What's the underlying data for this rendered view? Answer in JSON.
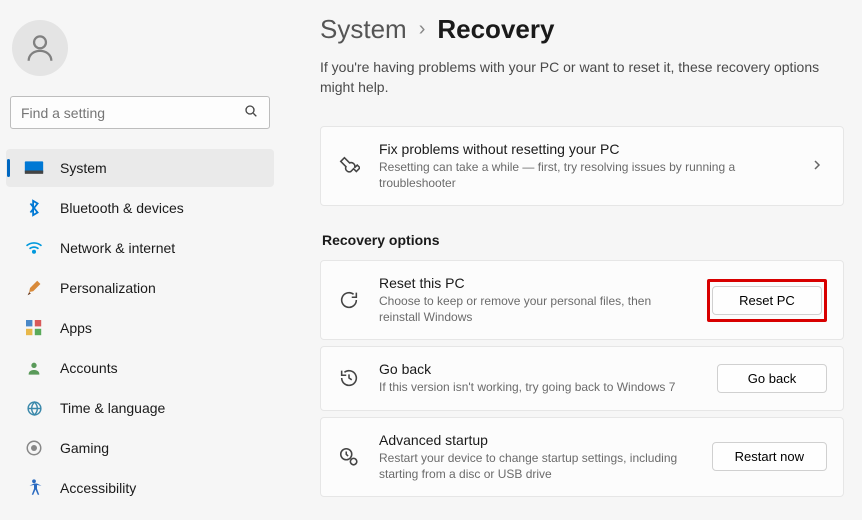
{
  "search": {
    "placeholder": "Find a setting"
  },
  "sidebar": {
    "items": [
      {
        "label": "System"
      },
      {
        "label": "Bluetooth & devices"
      },
      {
        "label": "Network & internet"
      },
      {
        "label": "Personalization"
      },
      {
        "label": "Apps"
      },
      {
        "label": "Accounts"
      },
      {
        "label": "Time & language"
      },
      {
        "label": "Gaming"
      },
      {
        "label": "Accessibility"
      }
    ]
  },
  "breadcrumb": {
    "parent": "System",
    "current": "Recovery"
  },
  "intro": "If you're having problems with your PC or want to reset it, these recovery options might help.",
  "cards": {
    "fix": {
      "title": "Fix problems without resetting your PC",
      "desc": "Resetting can take a while — first, try resolving issues by running a troubleshooter"
    },
    "section_header": "Recovery options",
    "reset": {
      "title": "Reset this PC",
      "desc": "Choose to keep or remove your personal files, then reinstall Windows",
      "button": "Reset PC"
    },
    "goback": {
      "title": "Go back",
      "desc": "If this version isn't working, try going back to Windows 7",
      "button": "Go back"
    },
    "advanced": {
      "title": "Advanced startup",
      "desc": "Restart your device to change startup settings, including starting from a disc or USB drive",
      "button": "Restart now"
    }
  }
}
